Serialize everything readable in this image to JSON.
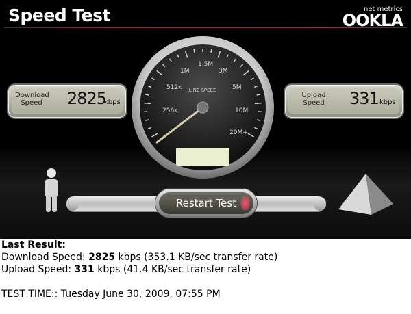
{
  "header": {
    "title": "Speed Test",
    "logo_tag": "net metrics",
    "logo_name": "OOKLA"
  },
  "download": {
    "label_line1": "Download",
    "label_line2": "Speed",
    "value": "2825",
    "unit": "kbps"
  },
  "upload": {
    "label_line1": "Upload",
    "label_line2": "Speed",
    "value": "331",
    "unit": "kbps"
  },
  "gauge": {
    "center_label": "LINE SPEED",
    "scale_labels": [
      "256k",
      "512k",
      "1M",
      "1.5M",
      "3M",
      "5M",
      "10M",
      "20M+"
    ]
  },
  "restart_button": {
    "label": "Restart Test"
  },
  "result": {
    "heading": "Last Result:",
    "download_prefix": "Download Speed: ",
    "download_value": "2825",
    "download_suffix": " kbps (353.1 KB/sec transfer rate)",
    "upload_prefix": "Upload Speed: ",
    "upload_value": "331",
    "upload_suffix": " kbps (41.4 KB/sec transfer rate)",
    "test_time": "TEST TIME:: Tuesday June 30, 2009, 07:55 PM"
  }
}
